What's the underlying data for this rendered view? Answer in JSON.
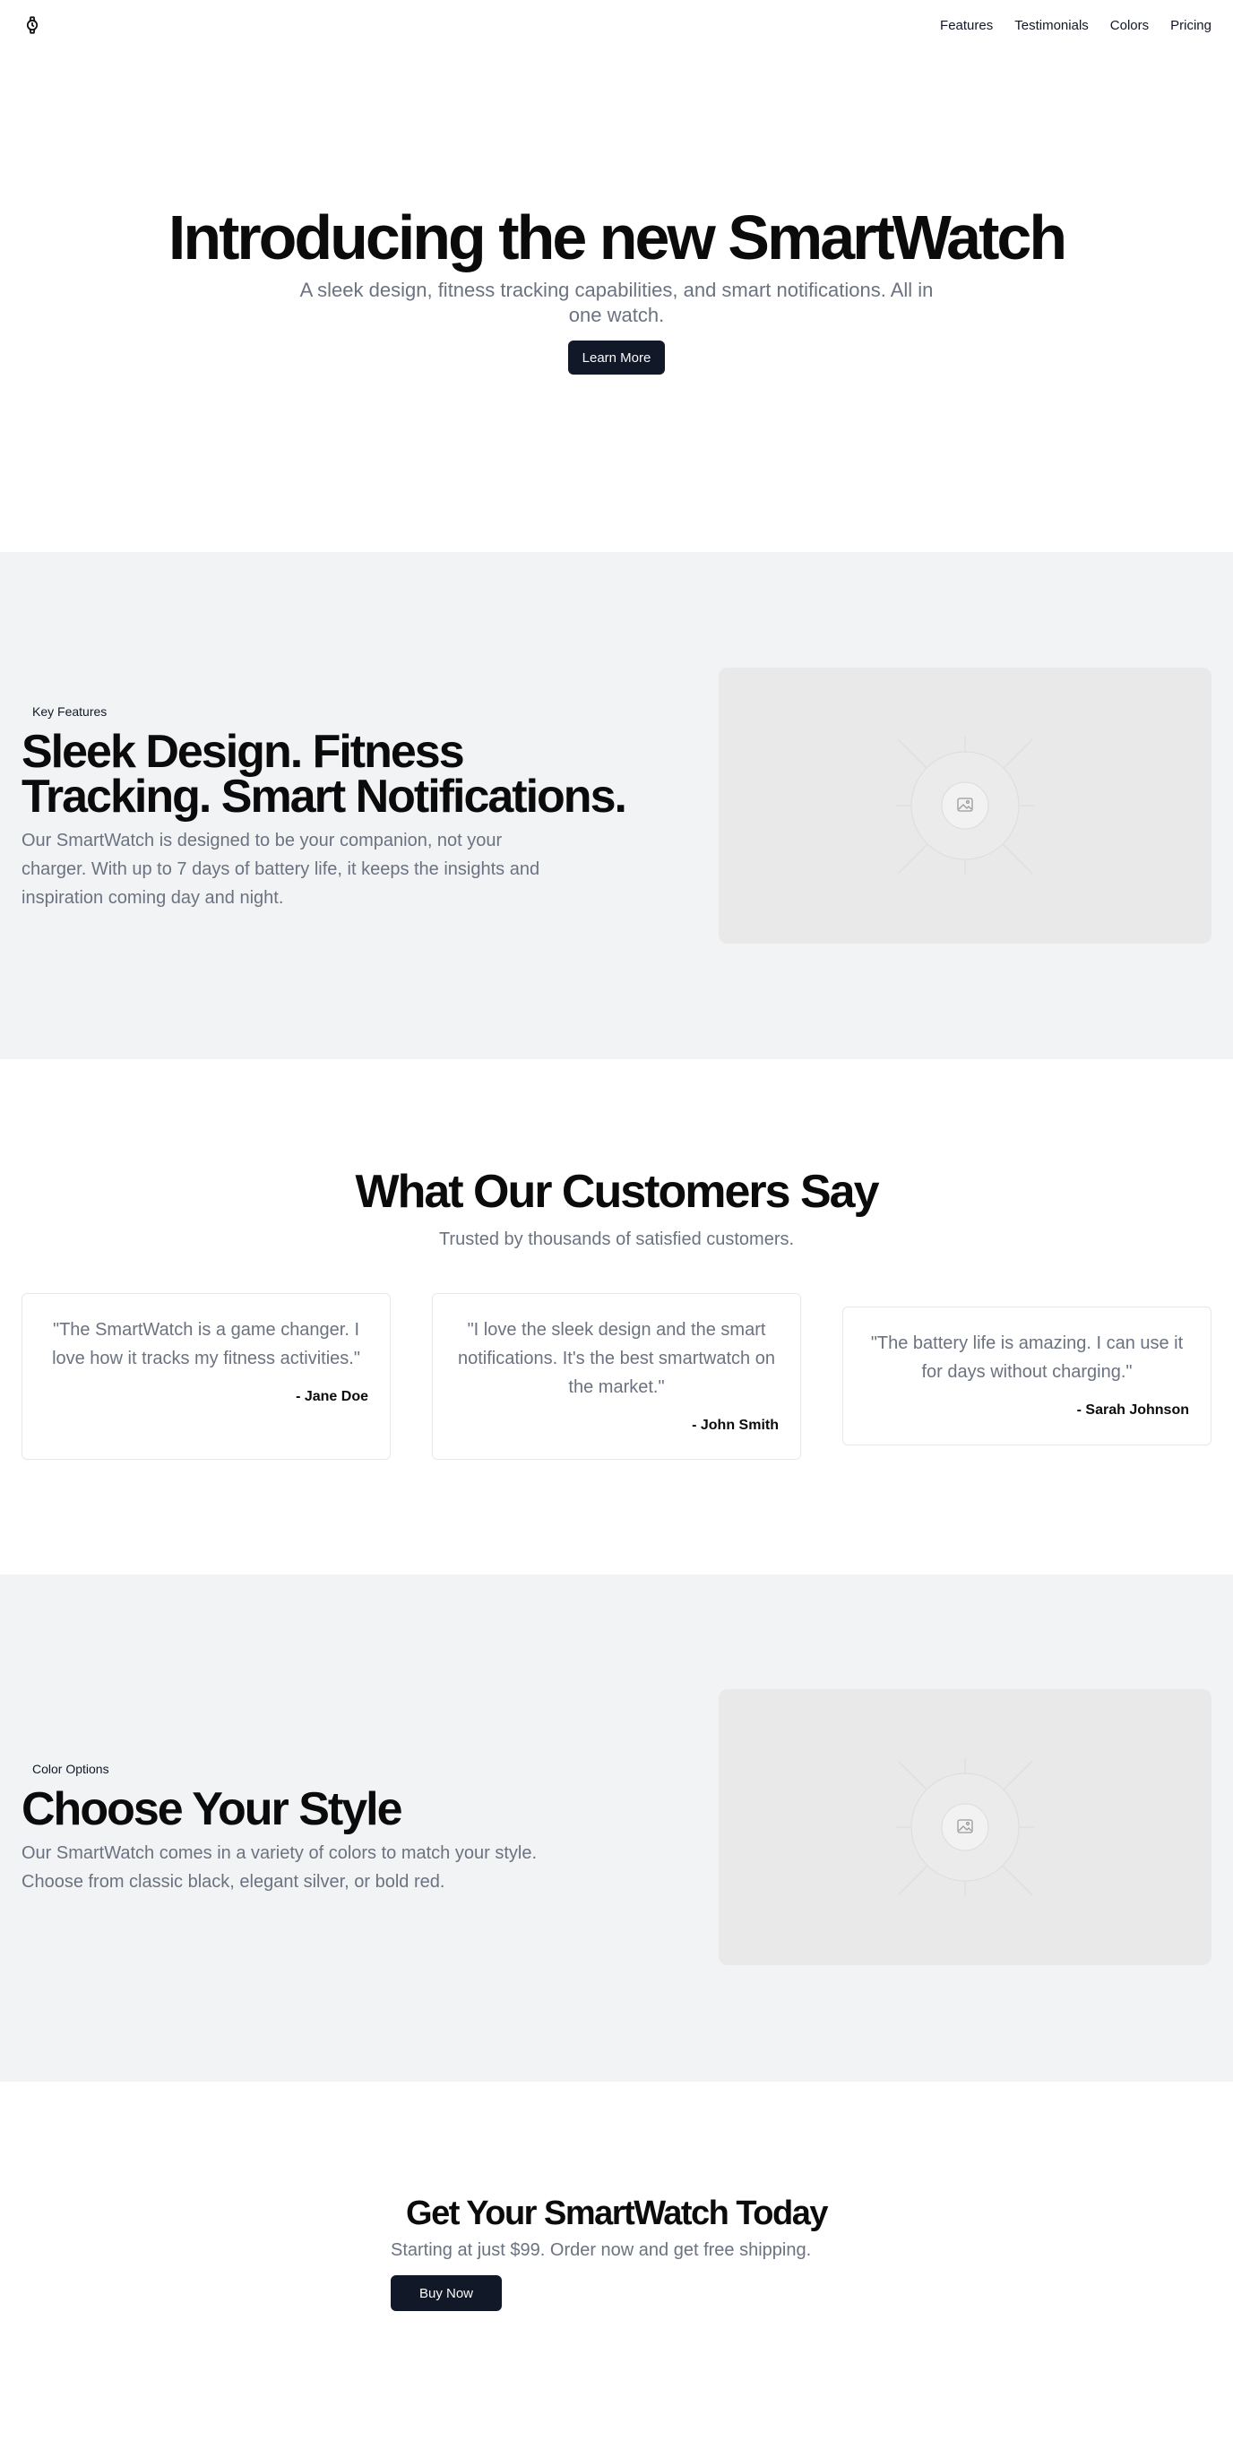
{
  "header": {
    "logo_icon": "watch-icon",
    "nav": [
      {
        "label": "Features"
      },
      {
        "label": "Testimonials"
      },
      {
        "label": "Colors"
      },
      {
        "label": "Pricing"
      }
    ]
  },
  "hero": {
    "title": "Introducing the new SmartWatch",
    "subtitle": "A sleek design, fitness tracking capabilities, and smart notifications. All in one watch.",
    "button_label": "Learn More"
  },
  "features": {
    "pill": "Key Features",
    "title": "Sleek Design. Fitness Tracking. Smart Notifications.",
    "body": "Our SmartWatch is designed to be your companion, not your charger. With up to 7 days of battery life, it keeps the insights and inspiration coming day and night.",
    "image_icon": "image-placeholder-icon"
  },
  "testimonials": {
    "title": "What Our Customers Say",
    "subtitle": "Trusted by thousands of satisfied customers.",
    "items": [
      {
        "quote": "\"The SmartWatch is a game changer. I love how it tracks my fitness activities.\"",
        "author": "- Jane Doe"
      },
      {
        "quote": "\"I love the sleek design and the smart notifications. It's the best smartwatch on the market.\"",
        "author": "- John Smith"
      },
      {
        "quote": "\"The battery life is amazing. I can use it for days without charging.\"",
        "author": "- Sarah Johnson"
      }
    ]
  },
  "colors": {
    "pill": "Color Options",
    "title": "Choose Your Style",
    "body": "Our SmartWatch comes in a variety of colors to match your style. Choose from classic black, elegant silver, or bold red.",
    "image_icon": "image-placeholder-icon"
  },
  "cta": {
    "title": "Get Your SmartWatch Today",
    "subtitle": "Starting at just $99. Order now and get free shipping.",
    "button_label": "Buy Now"
  },
  "theme": {
    "primary": "#111827",
    "muted_text": "#6b7280",
    "section_gray": "#f2f3f5",
    "placeholder_bg": "#e9e9e9"
  }
}
